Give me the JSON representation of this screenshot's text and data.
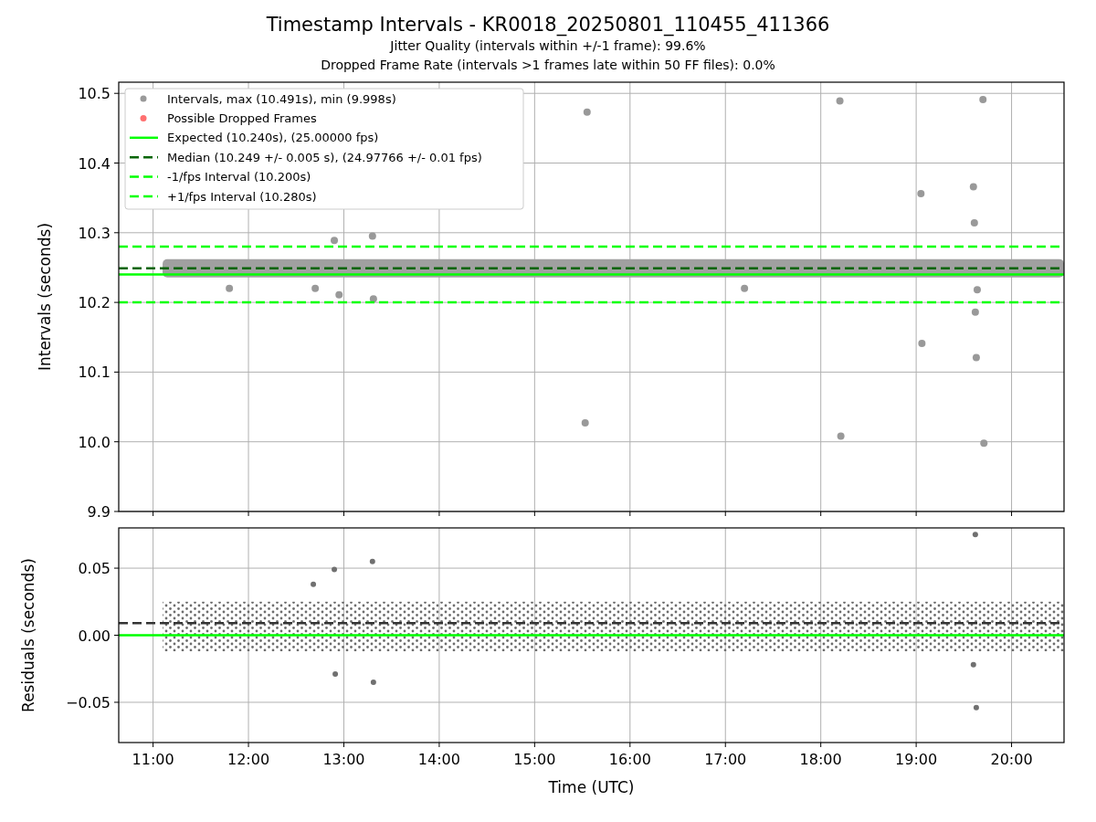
{
  "figure": {
    "title": "Timestamp Intervals - KR0018_20250801_110455_411366",
    "subtitles": [
      "Jitter Quality (intervals within +/-1 frame): 99.6%",
      "Dropped Frame Rate (intervals >1 frames late within 50 FF files): 0.0%"
    ]
  },
  "top_chart": {
    "chart_data": {
      "type": "scatter",
      "ylabel": "Intervals (seconds)",
      "grid": true,
      "xlim": [
        10.64,
        20.55
      ],
      "ylim": [
        9.9,
        10.516
      ],
      "x": [
        11.8,
        12.7,
        12.9,
        12.95,
        13.3,
        13.31,
        15.53,
        15.55,
        17.2,
        18.2,
        18.21,
        19.05,
        19.06,
        19.6,
        19.61,
        19.62,
        19.63,
        19.64,
        19.7,
        19.71
      ],
      "series": [
        {
          "name": "Intervals, max (10.491s), min (9.998s)",
          "color": "#999999",
          "values": [
            10.22,
            10.22,
            10.289,
            10.211,
            10.295,
            10.205,
            10.027,
            10.473,
            10.22,
            10.489,
            10.008,
            10.356,
            10.141,
            10.366,
            10.314,
            10.186,
            10.121,
            10.218,
            10.491,
            9.998
          ]
        },
        {
          "name": "Possible Dropped Frames",
          "color": "#ff7070",
          "values": [
            null,
            null,
            null,
            null,
            null,
            null,
            null,
            null,
            null,
            null,
            null,
            null,
            null,
            null,
            null,
            null,
            null,
            null,
            null,
            null
          ]
        }
      ],
      "ref_lines": [
        {
          "axis": "y",
          "value": 10.24,
          "label": "Expected (10.240s), (25.00000 fps)",
          "color": "#00ff00"
        },
        {
          "axis": "y",
          "value": 10.249,
          "label": "Median (10.249 +/- 0.005 s), (24.97766 +/- 0.01 fps)",
          "color": "#006400"
        },
        {
          "axis": "y",
          "value": 10.2,
          "label": "-1/fps Interval (10.200s)",
          "color": "#00ff00"
        },
        {
          "axis": "y",
          "value": 10.28,
          "label": "+1/fps Interval (10.280s)",
          "color": "#00ff00"
        }
      ],
      "legend": true,
      "bands": [
        {
          "axis": "y",
          "from": 10.236,
          "to": 10.262,
          "color": "#a0a0a0"
        }
      ],
      "yticks": [
        {
          "value": 9.9,
          "label": "9.9"
        },
        {
          "value": 10.0,
          "label": "10.0"
        },
        {
          "value": 10.1,
          "label": "10.1"
        },
        {
          "value": 10.2,
          "label": "10.2"
        },
        {
          "value": 10.3,
          "label": "10.3"
        },
        {
          "value": 10.4,
          "label": "10.4"
        },
        {
          "value": 10.5,
          "label": "10.5"
        }
      ]
    }
  },
  "bottom_chart": {
    "chart_data": {
      "type": "scatter",
      "xlabel": "Time (UTC)",
      "ylabel": "Residuals (seconds)",
      "grid": true,
      "xlim": [
        10.64,
        20.55
      ],
      "ylim": [
        -0.08,
        0.08
      ],
      "x": [
        12.68,
        12.9,
        12.91,
        13.3,
        13.31,
        19.6,
        19.62,
        19.63
      ],
      "series": [
        {
          "color": "#707070",
          "values": [
            0.038,
            0.049,
            -0.029,
            0.055,
            -0.035,
            -0.022,
            0.075,
            -0.054
          ]
        }
      ],
      "ref_lines": [
        {
          "axis": "y",
          "value": 0.009,
          "color": "#333333"
        },
        {
          "axis": "y",
          "value": 0,
          "color": "#00ff00"
        }
      ],
      "bands": [
        {
          "axis": "y",
          "from": -0.012,
          "to": 0.025,
          "color": "#6e6e6e"
        }
      ],
      "xticks": [
        {
          "value": 11,
          "label": "11:00"
        },
        {
          "value": 12,
          "label": "12:00"
        },
        {
          "value": 13,
          "label": "13:00"
        },
        {
          "value": 14,
          "label": "14:00"
        },
        {
          "value": 15,
          "label": "15:00"
        },
        {
          "value": 16,
          "label": "16:00"
        },
        {
          "value": 17,
          "label": "17:00"
        },
        {
          "value": 18,
          "label": "18:00"
        },
        {
          "value": 19,
          "label": "19:00"
        },
        {
          "value": 20,
          "label": "20:00"
        }
      ],
      "yticks": [
        {
          "value": 0.05,
          "label": "0.05"
        },
        {
          "value": 0,
          "label": "0.00"
        },
        {
          "value": -0.05,
          "label": "−0.05"
        }
      ]
    }
  }
}
